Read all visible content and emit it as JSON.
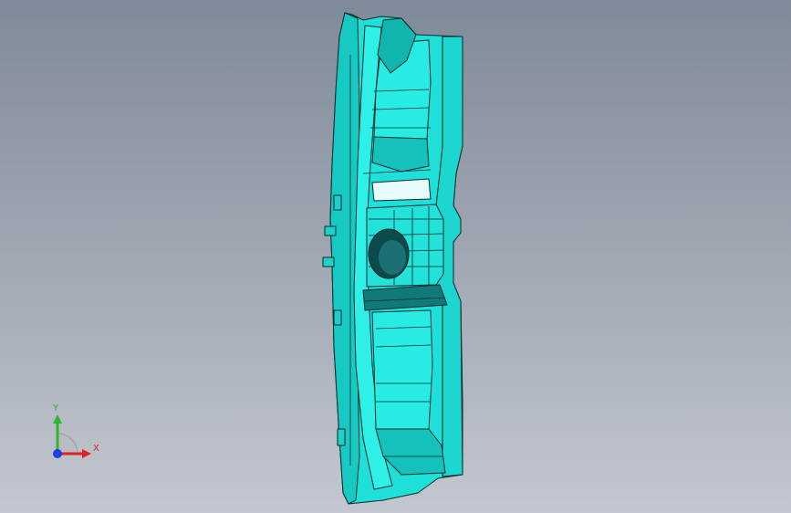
{
  "view": {
    "background_top": "#7f8a98",
    "background_bottom": "#c3c7cf",
    "part_color": "#22e8e0",
    "part_shade": "#11bdb8",
    "edge_color": "#0b2a2a"
  },
  "triad": {
    "x_label": "X",
    "y_label": "Y",
    "x_color": "#e0202a",
    "y_color": "#2fb52f",
    "z_color": "#1f3fe0"
  }
}
